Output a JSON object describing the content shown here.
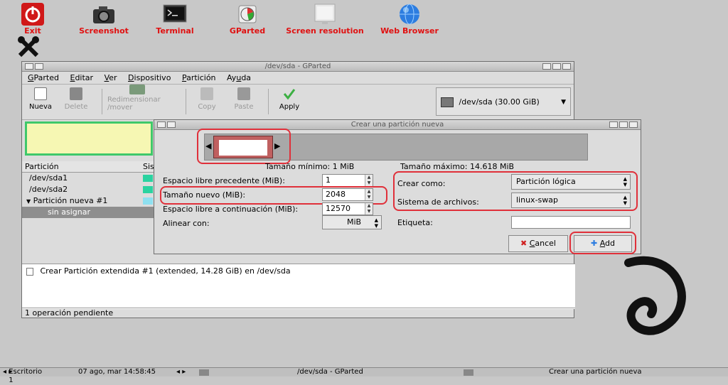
{
  "desktop": {
    "icons": [
      {
        "label": "Exit",
        "icon": "power-icon"
      },
      {
        "label": "Screenshot",
        "icon": "camera-icon"
      },
      {
        "label": "Terminal",
        "icon": "terminal-icon"
      },
      {
        "label": "GParted",
        "icon": "gparted-icon"
      },
      {
        "label": "Screen resolution",
        "icon": "monitor-icon"
      },
      {
        "label": "Web Browser",
        "icon": "globe-icon"
      }
    ]
  },
  "main_window": {
    "title": "/dev/sda - GParted",
    "menu": [
      {
        "pre": "",
        "ul": "G",
        "post": "Parted"
      },
      {
        "pre": "",
        "ul": "E",
        "post": "ditar"
      },
      {
        "pre": "",
        "ul": "V",
        "post": "er"
      },
      {
        "pre": "",
        "ul": "D",
        "post": "ispositivo"
      },
      {
        "pre": "",
        "ul": "P",
        "post": "artición"
      },
      {
        "pre": "Ay",
        "ul": "u",
        "post": "da"
      }
    ],
    "toolbar": {
      "new": "Nueva",
      "delete": "Delete",
      "resize_line1": "Redimensionar",
      "resize_line2": "/mover",
      "copy": "Copy",
      "paste": "Paste",
      "apply": "Apply"
    },
    "device": "/dev/sda  (30.00 GiB)",
    "table": {
      "col_partition": "Partición",
      "col_fs": "Sis",
      "rows": [
        "/dev/sda1",
        "/dev/sda2",
        "Partición nueva #1",
        "sin asignar"
      ]
    },
    "operation": "Crear Partición extendida #1 (extended, 14.28 GiB) en /dev/sda",
    "status": "1 operación pendiente"
  },
  "dialog": {
    "title": "Crear una partición nueva",
    "min_size": "Tamaño mínimo: 1 MiB",
    "max_size": "Tamaño máximo: 14.618 MiB",
    "free_before_label": "Espacio libre precedente (MiB):",
    "free_before_value": "1",
    "new_size_label": "Tamaño nuevo (MiB):",
    "new_size_value": "2048",
    "free_after_label": "Espacio libre a continuación (MiB):",
    "free_after_value": "12570",
    "align_label": "Alinear con:",
    "align_value": "MiB",
    "create_as_label": "Crear como:",
    "create_as_value": "Partición lógica",
    "fs_label": "Sistema de archivos:",
    "fs_value": "linux-swap",
    "tag_label": "Etiqueta:",
    "tag_value": "",
    "cancel_ul": "C",
    "cancel_rest": "ancel",
    "add_ul": "A",
    "add_rest": "dd"
  },
  "taskbar": {
    "desktop": "Escritorio 1",
    "datetime": "07 ago, mar 14:58:45",
    "task1": "/dev/sda - GParted",
    "task2": "Crear una partición nueva"
  },
  "colors": {
    "label_red": "#e01010",
    "highlight_red": "#e0303a",
    "partition_green": "#3fc86a",
    "partition_yellow": "#f6f7b3"
  }
}
